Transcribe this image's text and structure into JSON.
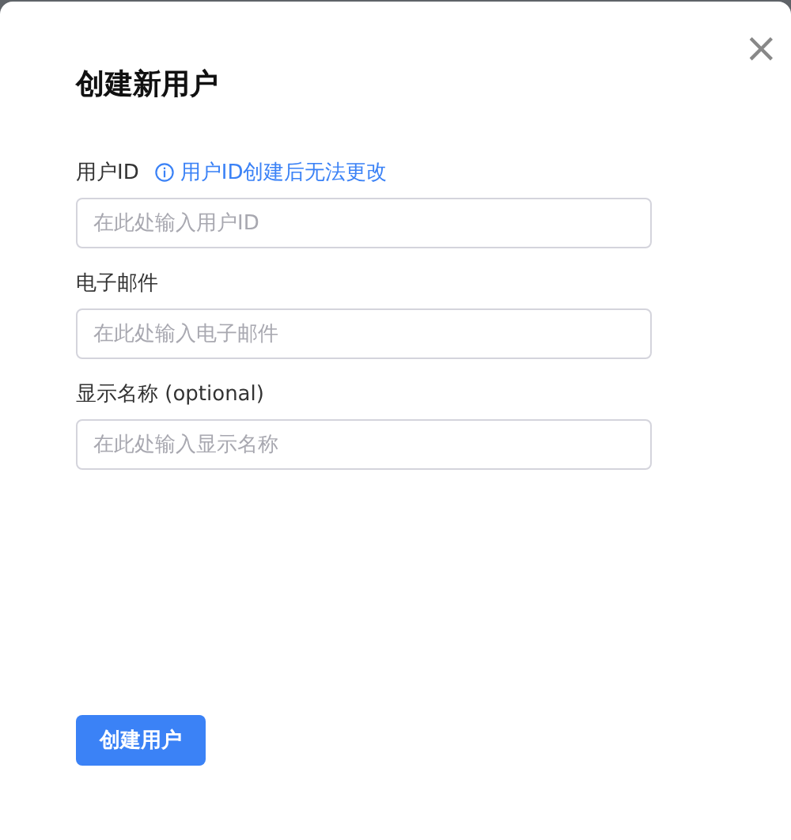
{
  "dialog": {
    "title": "创建新用户",
    "close": "×"
  },
  "fields": [
    {
      "label": "用户ID",
      "hint": "用户ID创建后无法更改",
      "placeholder": "在此处输入用户ID"
    },
    {
      "label": "电子邮件",
      "placeholder": "在此处输入电子邮件"
    },
    {
      "label": "显示名称 (optional)",
      "placeholder": "在此处输入显示名称"
    }
  ],
  "submit": "创建用户"
}
